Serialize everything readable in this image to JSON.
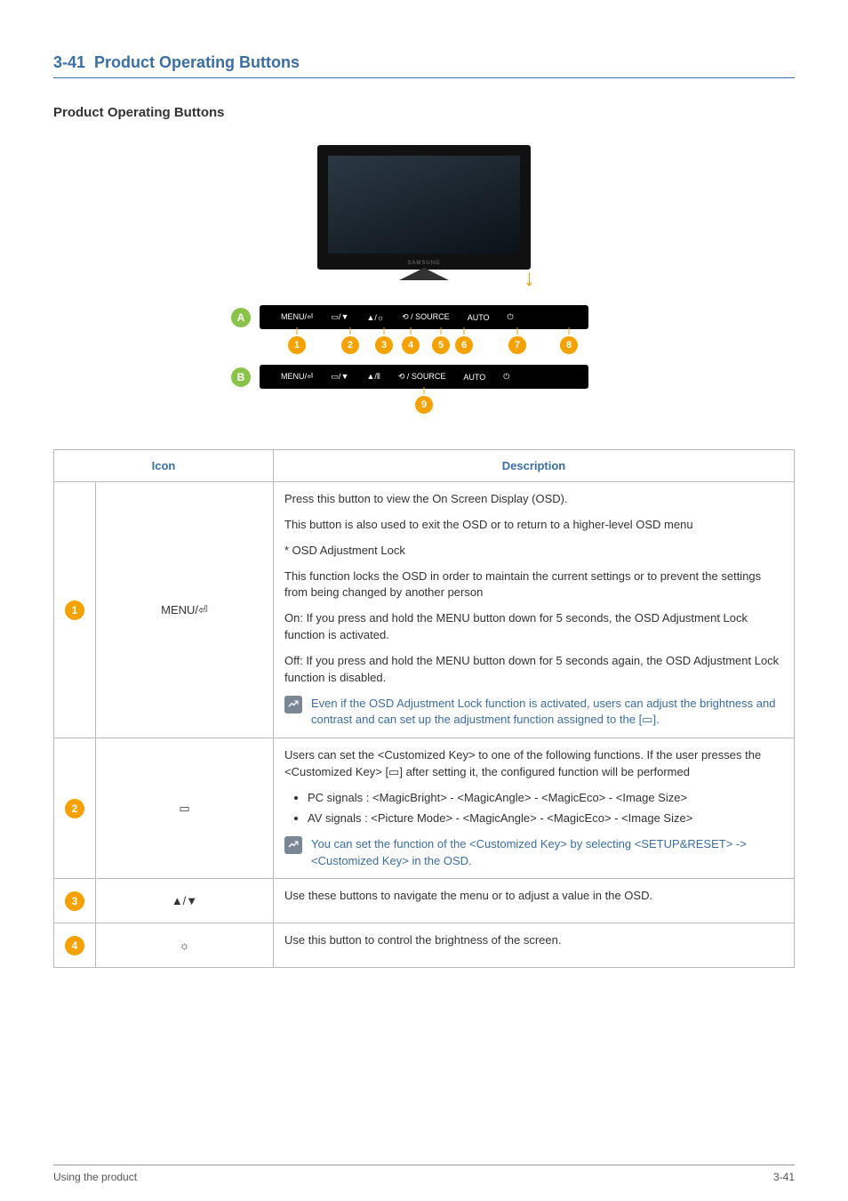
{
  "section": {
    "number": "3-41",
    "title": "Product Operating Buttons"
  },
  "subheading": "Product Operating Buttons",
  "figure": {
    "monitor_brand": "SAMSUNG",
    "strips": [
      {
        "badge": "A",
        "items": [
          "MENU/⏎",
          "▭/▼",
          "▲/☼",
          "⟲ / SOURCE",
          "AUTO",
          "⏻"
        ],
        "callouts": [
          "1",
          "2",
          "3",
          "4",
          "5",
          "6",
          "7",
          "8"
        ]
      },
      {
        "badge": "B",
        "items": [
          "MENU/⏎",
          "▭/▼",
          "▲/⦀",
          "⟲ / SOURCE",
          "AUTO",
          "⏻"
        ],
        "callouts": [
          "9"
        ]
      }
    ]
  },
  "table": {
    "headers": {
      "icon": "Icon",
      "description": "Description"
    },
    "rows": [
      {
        "badge": "1",
        "icon_label": "MENU/⏎",
        "desc": {
          "p1": "Press this button to view the On Screen Display (OSD).",
          "p2": "This button is also used to exit the OSD or to return to a higher-level OSD menu",
          "p3": "* OSD Adjustment Lock",
          "p4": "This function locks the OSD in order to maintain the current settings or to prevent the settings from being changed by another person",
          "p5": "On: If you press and hold the MENU button down for 5 seconds, the OSD Adjustment Lock function is activated.",
          "p6": "Off: If you press and hold the MENU button down for 5 seconds again, the OSD Adjustment Lock function is disabled.",
          "note": "Even if the OSD Adjustment Lock function is activated, users can adjust the brightness and contrast and can set up the adjustment function assigned to the [▭]."
        }
      },
      {
        "badge": "2",
        "icon_label": "▭",
        "desc": {
          "p1": "Users can set the <Customized Key> to one of the following functions. If the user presses the <Customized Key> [▭] after setting it, the configured function will be performed",
          "bullets": [
            "PC signals : <MagicBright> - <MagicAngle> - <MagicEco> - <Image Size>",
            "AV signals : <Picture Mode> - <MagicAngle> - <MagicEco> - <Image Size>"
          ],
          "note": "You can set the function of the <Customized Key> by selecting <SETUP&RESET> -> <Customized Key> in the OSD."
        }
      },
      {
        "badge": "3",
        "icon_label": "▲/▼",
        "desc": {
          "p1": "Use these buttons to navigate the menu or to adjust a value in the OSD."
        }
      },
      {
        "badge": "4",
        "icon_label": "☼",
        "desc": {
          "p1": "Use this button to control the brightness of the screen."
        }
      }
    ]
  },
  "footer": {
    "left": "Using the product",
    "right": "3-41"
  }
}
